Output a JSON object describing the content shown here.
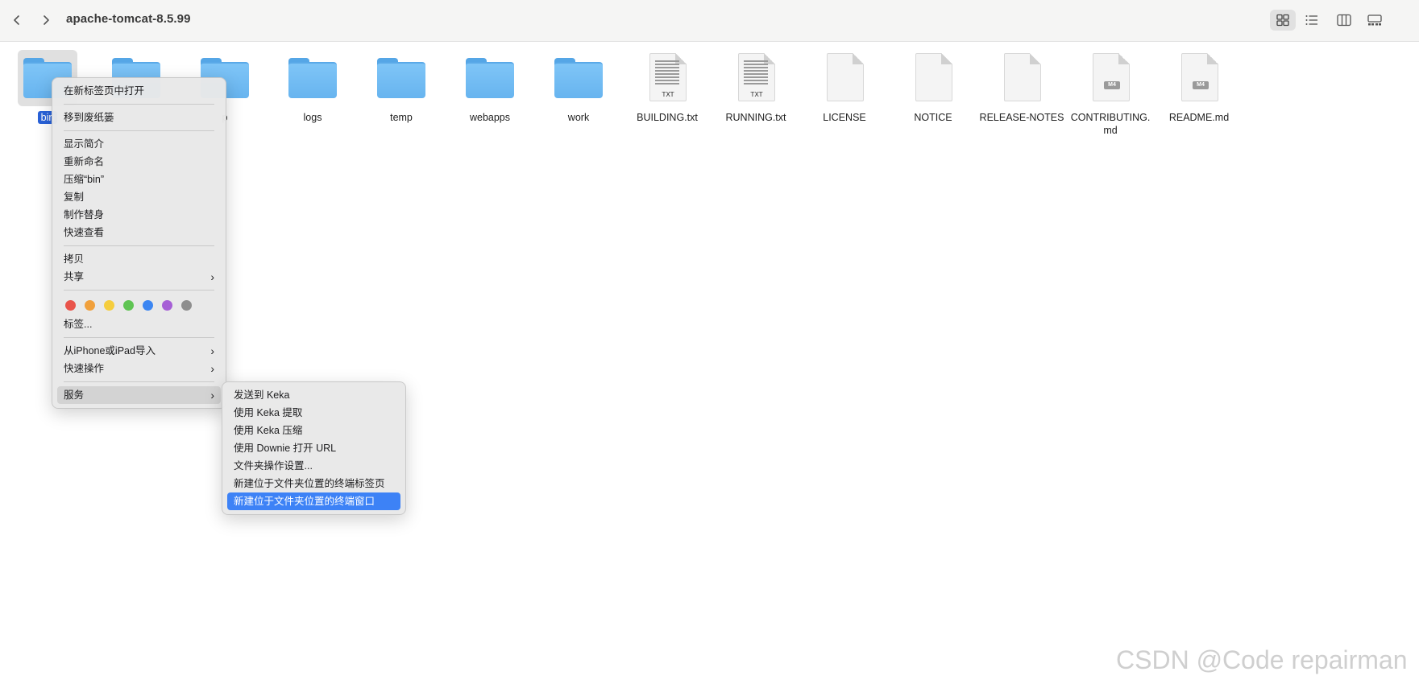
{
  "window": {
    "title": "apache-tomcat-8.5.99"
  },
  "toolbar": {
    "back_icon": "chevron-left-icon",
    "forward_icon": "chevron-right-icon",
    "views": [
      "icon-view",
      "list-view",
      "column-view",
      "gallery-view"
    ],
    "active_view": "icon-view"
  },
  "items": [
    {
      "label": "bin",
      "kind": "folder",
      "selected": true
    },
    {
      "label": "",
      "kind": "folder"
    },
    {
      "label": "p",
      "kind": "folder"
    },
    {
      "label": "logs",
      "kind": "folder"
    },
    {
      "label": "temp",
      "kind": "folder"
    },
    {
      "label": "webapps",
      "kind": "folder"
    },
    {
      "label": "work",
      "kind": "folder"
    },
    {
      "label": "BUILDING.txt",
      "kind": "txt",
      "badge": "TXT"
    },
    {
      "label": "RUNNING.txt",
      "kind": "txt",
      "badge": "TXT"
    },
    {
      "label": "LICENSE",
      "kind": "blank"
    },
    {
      "label": "NOTICE",
      "kind": "blank"
    },
    {
      "label": "RELEASE-NOTES",
      "kind": "blank"
    },
    {
      "label": "CONTRIBUTING.\nmd",
      "kind": "md",
      "badge": "M4"
    },
    {
      "label": "README.md",
      "kind": "md",
      "badge": "M4"
    }
  ],
  "context_menu": {
    "open_new_tab": "在新标签页中打开",
    "move_to_trash": "移到废纸篓",
    "get_info": "显示简介",
    "rename": "重新命名",
    "compress": "压缩“bin”",
    "duplicate": "复制",
    "make_alias": "制作替身",
    "quick_look": "快速查看",
    "copy": "拷贝",
    "share": "共享",
    "tag_colors": [
      "#e9544b",
      "#f0a03c",
      "#f5cd3d",
      "#5fc453",
      "#3c86f2",
      "#a65fd6",
      "#8e8e8e"
    ],
    "tags": "标签...",
    "import_from_iphone": "从iPhone或iPad导入",
    "quick_actions": "快速操作",
    "services": "服务"
  },
  "services_menu": {
    "send_to_keka": "发送到 Keka",
    "extract_keka": "使用 Keka 提取",
    "compress_keka": "使用 Keka 压缩",
    "downie_open_url": "使用 Downie 打开 URL",
    "folder_actions_setup": "文件夹操作设置...",
    "new_terminal_tab": "新建位于文件夹位置的终端标签页",
    "new_terminal_window": "新建位于文件夹位置的终端窗口"
  },
  "watermark": "CSDN @Code repairman"
}
